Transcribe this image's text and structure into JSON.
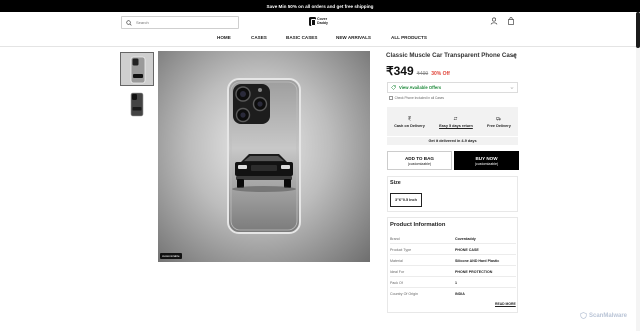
{
  "promo": {
    "text": "Save Min 50% on all orders and get free shipping"
  },
  "header": {
    "search_placeholder": "Search",
    "logo_line1": "Cover",
    "logo_line2": "Daddy",
    "account_icon": "user-icon",
    "bag_icon": "shopping-bag-icon"
  },
  "nav": {
    "items": [
      {
        "label": "HOME"
      },
      {
        "label": "CASES"
      },
      {
        "label": "BASIC CASES"
      },
      {
        "label": "NEW ARRIVALS"
      },
      {
        "label": "ALL PRODUCTS"
      }
    ]
  },
  "gallery": {
    "badge": "customizable"
  },
  "product": {
    "title": "Classic Muscle Car Transparent Phone Case",
    "price": "₹349",
    "mrp": "₹499",
    "discount": "30% Off",
    "offers_label": "View Available Offers",
    "check_note": "Check Phone Included in all Cases",
    "features": [
      {
        "label": "Cash on Delivery",
        "icon": "rupee-icon"
      },
      {
        "label": "Easy 5 days return",
        "icon": "return-icon"
      },
      {
        "label": "Free Delivery",
        "icon": "truck-icon"
      }
    ],
    "delivery_note": "Get it delivered in 4-9 days",
    "add_to_bag": {
      "label": "ADD TO BAG",
      "sub": "(customizable)"
    },
    "buy_now": {
      "label": "BUY NOW",
      "sub": "(customizable)"
    },
    "size_heading": "Size",
    "size_option": "3\"6\"0.5 Inch"
  },
  "info": {
    "heading": "Product Information",
    "rows": [
      {
        "key": "Brand",
        "value": "Coverdaddy"
      },
      {
        "key": "Product Type",
        "value": "PHONE CASE"
      },
      {
        "key": "Material",
        "value": "Silicone AND Hard Plastic"
      },
      {
        "key": "Ideal For",
        "value": "PHONE PROTECTION"
      },
      {
        "key": "Pack Of",
        "value": "1"
      },
      {
        "key": "Country Of Origin",
        "value": "INDIA"
      }
    ],
    "read_more": "READ MORE"
  },
  "watermark": {
    "text": "ScanMalware"
  },
  "colors": {
    "accent_green": "#1f8a3b",
    "discount_red": "#e0453a",
    "dark": "#000000"
  }
}
